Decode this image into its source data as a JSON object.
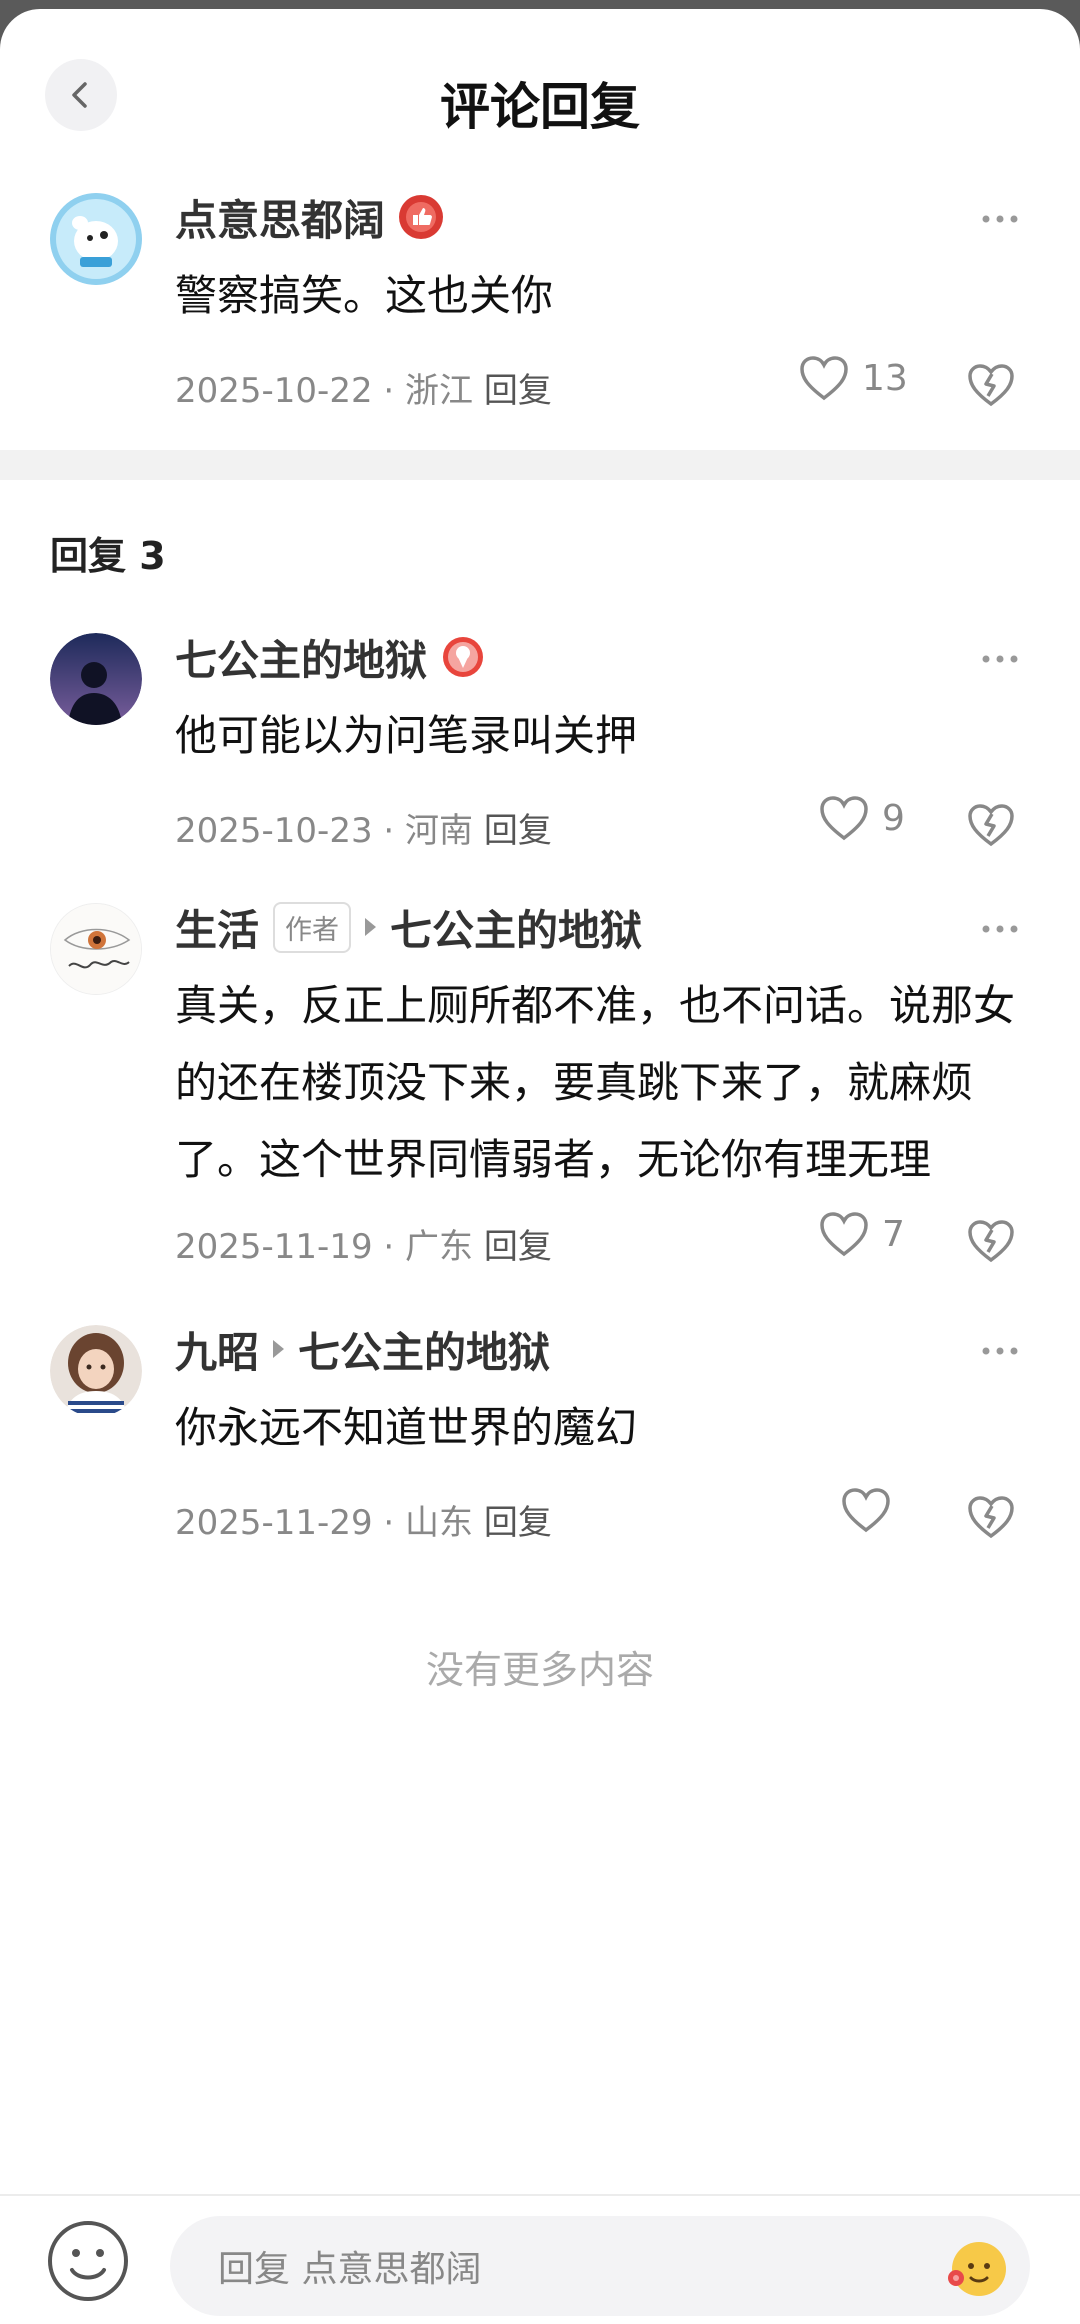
{
  "header": {
    "title": "评论回复"
  },
  "main_comment": {
    "author": "点意思都阔",
    "text": "警察搞笑。这也关你",
    "date": "2025-10-22",
    "location": "浙江",
    "reply_label": "回复",
    "likes": "13"
  },
  "replies_header": "回复 3",
  "replies": [
    {
      "author": "七公主的地狱",
      "text": "他可能以为问笔录叫关押",
      "date": "2025-10-23",
      "location": "河南",
      "reply_label": "回复",
      "likes": "9"
    },
    {
      "author": "生活",
      "author_tag": "作者",
      "reply_to": "七公主的地狱",
      "text": "真关，反正上厕所都不准，也不问话。说那女的还在楼顶没下来，要真跳下来了，就麻烦了。这个世界同情弱者，无论你有理无理",
      "date": "2025-11-19",
      "location": "广东",
      "reply_label": "回复",
      "likes": "7"
    },
    {
      "author": "九昭",
      "reply_to": "七公主的地狱",
      "text": "你永远不知道世界的魔幻",
      "date": "2025-11-29",
      "location": "山东",
      "reply_label": "回复",
      "likes": ""
    }
  ],
  "footer_text": "没有更多内容",
  "bottom_bar": {
    "placeholder": "回复 点意思都阔"
  },
  "colors": {
    "badge_red": "#e8453c",
    "meta_gray": "#888888"
  },
  "icons": [
    "back-chevron-icon",
    "thumbs-up-badge-icon",
    "ice-cream-badge-icon",
    "more-dots-icon",
    "heart-outline-icon",
    "broken-heart-icon",
    "smiley-face-icon",
    "sticker-emoji-icon"
  ]
}
